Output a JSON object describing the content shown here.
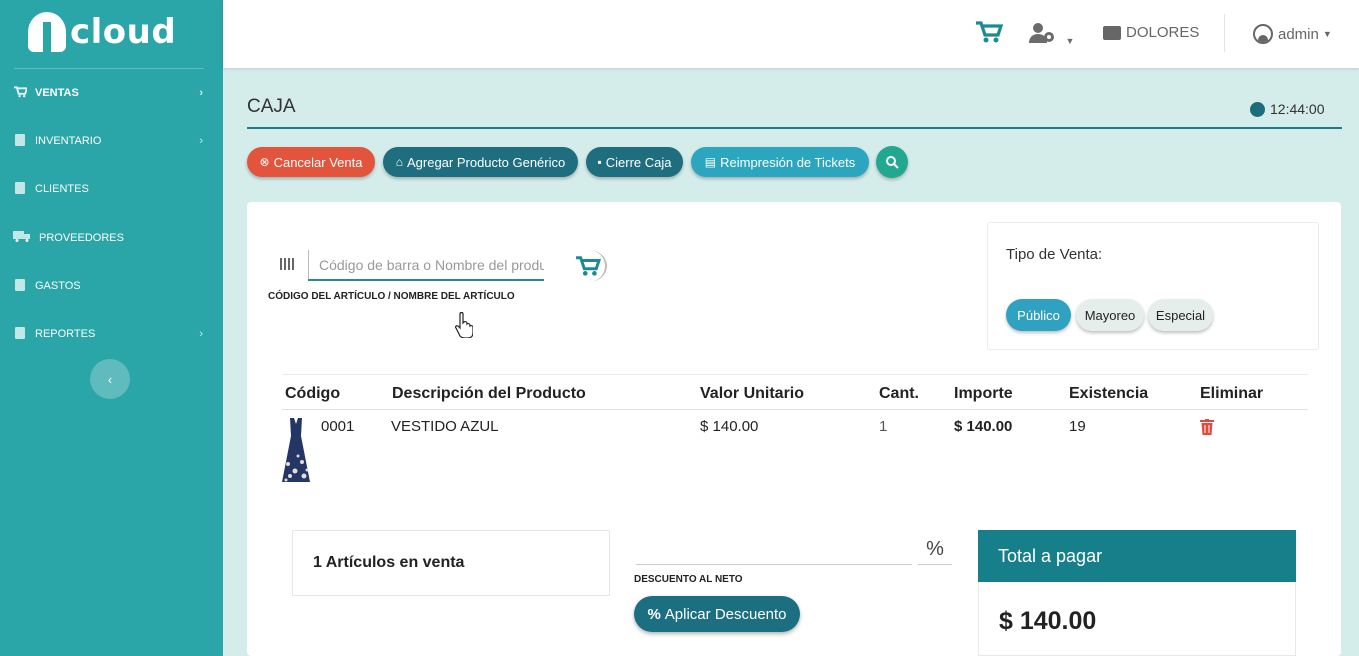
{
  "app": {
    "logo_text": "cloud"
  },
  "sidebar": {
    "items": [
      {
        "label": "VENTAS",
        "icon": "cart-icon",
        "has_submenu": true,
        "active": true
      },
      {
        "label": "INVENTARIO",
        "icon": "clipboard-icon",
        "has_submenu": true
      },
      {
        "label": "CLIENTES",
        "icon": "contact-book-icon",
        "has_submenu": false
      },
      {
        "label": "PROVEEDORES",
        "icon": "truck-icon",
        "has_submenu": false
      },
      {
        "label": "GASTOS",
        "icon": "document-icon",
        "has_submenu": false
      },
      {
        "label": "REPORTES",
        "icon": "report-icon",
        "has_submenu": true
      }
    ],
    "collapse_icon": "chevron-left-icon"
  },
  "topbar": {
    "store_label": "DOLORES",
    "user_label": "admin"
  },
  "page": {
    "title": "CAJA",
    "time": "12:44:00"
  },
  "actions": {
    "cancel": "Cancelar Venta",
    "add_generic": "Agregar Producto Genérico",
    "close_register": "Cierre Caja",
    "reprint": "Reimpresión de Tickets"
  },
  "search": {
    "placeholder": "Código de barra o Nombre del producto",
    "label": "CÓDIGO DEL ARTÍCULO / NOMBRE DEL ARTÍCULO"
  },
  "sale_type": {
    "title": "Tipo de Venta:",
    "options": [
      "Público",
      "Mayoreo",
      "Especial"
    ],
    "selected": "Público"
  },
  "table": {
    "headers": [
      "Código",
      "Descripción del Producto",
      "Valor Unitario",
      "Cant.",
      "Importe",
      "Existencia",
      "Eliminar"
    ],
    "rows": [
      {
        "code": "0001",
        "description": "VESTIDO AZUL",
        "unit_price": "$ 140.00",
        "qty": "1",
        "amount": "$ 140.00",
        "stock": "19"
      }
    ]
  },
  "summary": {
    "items_count": "1 Artículos en venta",
    "discount_label": "DESCUENTO AL NETO",
    "discount_value": "",
    "percent_symbol": "%",
    "apply_label": "Aplicar Descuento",
    "total_label": "Total a pagar",
    "total_value": "$ 140.00"
  },
  "colors": {
    "sidebar": "#2aa5a8",
    "accent_dark": "#1e6e7f",
    "danger": "#e3543c",
    "total_header": "#167f8a"
  }
}
